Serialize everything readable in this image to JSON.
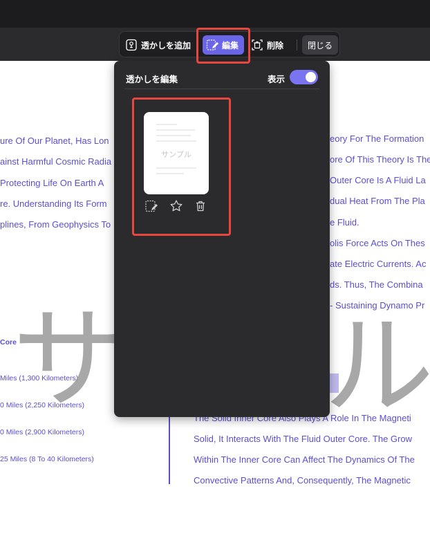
{
  "toolbar": {
    "add_label": "透かしを追加",
    "edit_label": "編集",
    "delete_label": "削除",
    "close_label": "閉じる"
  },
  "panel": {
    "title": "透かしを編集",
    "show_label": "表示",
    "show_enabled": true,
    "watermark_card_text": "サンプル"
  },
  "document": {
    "left_lines": [
      "ure Of Our Planet, Has Lon",
      "ainst Harmful Cosmic Radia",
      " Protecting Life On Earth A",
      "re. Understanding Its Form",
      "plines, From Geophysics To"
    ],
    "right_lines": [
      "eory For The Formation",
      "ore Of This Theory Is The",
      "Outer Core Is A Fluid La",
      "dual Heat From The Pla",
      "e Fluid.",
      "olis Force Acts On Thes",
      "ate Electric Currents. Ac",
      "ds. Thus, The Combina",
      "- Sustaining Dynamo Pr"
    ],
    "core_heading": "Core",
    "left_small_lines": [
      "Miles (1,300 Kilometers)",
      "0 Miles (2,250 Kilometers)",
      "0 Miles (2,900 Kilometers)",
      "25 Miles (8 To 40 Kilometers)"
    ],
    "right_bottom_lines": [
      "The Solid Inner Core Also Plays A Role In The Magneti",
      "Solid, It Interacts With The Fluid Outer Core. The Grow",
      "Within The Inner Core Can Affect The Dynamics Of The",
      "Convective Patterns And, Consequently, The Magnetic"
    ]
  },
  "watermark_preview": {
    "left_glyph": "サ",
    "right_glyph": "ル"
  },
  "colors": {
    "accent": "#6b65e8",
    "highlight_border": "#e8473f",
    "doc_text": "#5a4fd0",
    "panel_bg": "#2b2a2d"
  }
}
